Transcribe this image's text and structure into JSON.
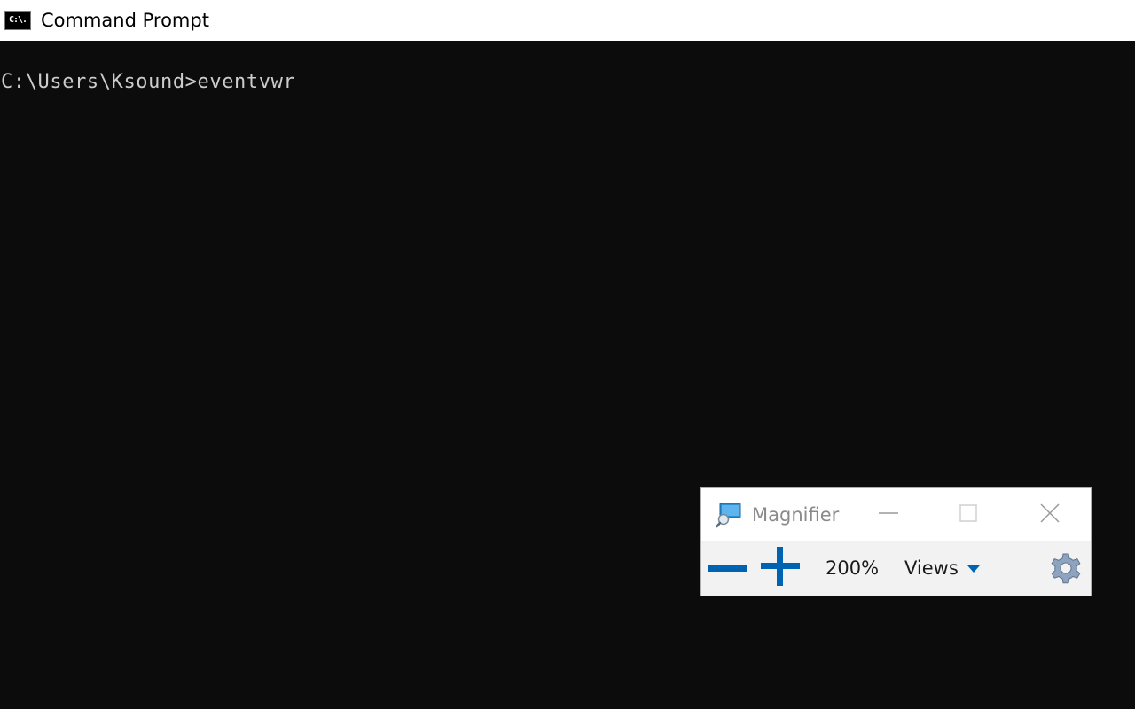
{
  "window": {
    "title": "Command Prompt",
    "icon": "cmd-icon",
    "icon_text": "C:\\."
  },
  "console": {
    "lines": [
      "C:\\Users\\Ksound>eventvwr"
    ]
  },
  "magnifier": {
    "title": "Magnifier",
    "zoom_level": "200%",
    "views_label": "Views",
    "icons": {
      "app": "magnifier-icon",
      "zoom_out": "minus-icon",
      "zoom_in": "plus-icon",
      "views_dropdown": "caret-down-icon",
      "settings": "gear-icon",
      "minimize": "minimize-icon",
      "maximize": "maximize-icon",
      "close": "close-icon"
    },
    "colors": {
      "accent": "#0063b1",
      "toolbar_bg": "#f2f2f2",
      "disabled": "#c8c8c8"
    }
  }
}
